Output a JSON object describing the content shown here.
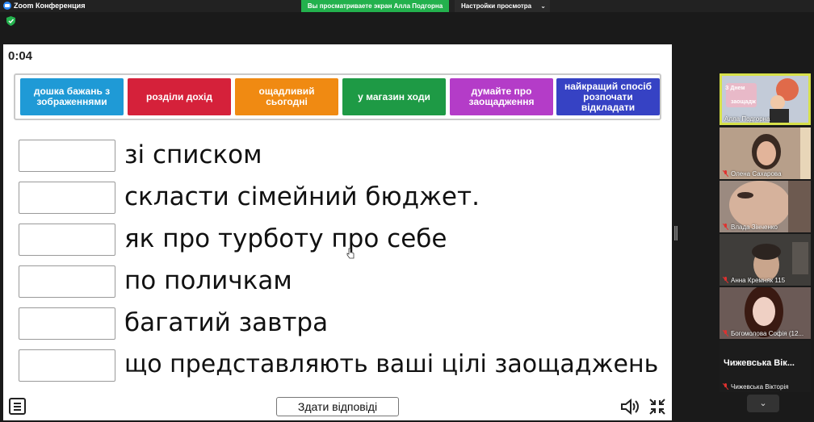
{
  "window": {
    "app_title": "Zoom Конференция",
    "share_banner": "Вы просматриваете экран Алла Подгорна",
    "view_settings": "Настройки просмотра"
  },
  "activity": {
    "timer": "0:04",
    "word_bank": [
      {
        "label": "дошка бажань з зображеннями",
        "color": "#1f9ad6"
      },
      {
        "label": "розділи дохід",
        "color": "#d5213a"
      },
      {
        "label": "ощадливий сьогодні",
        "color": "#f08a12"
      },
      {
        "label": "у магазин ходи",
        "color": "#1e9a45"
      },
      {
        "label": "думайте про заощадження",
        "color": "#b43cc8"
      },
      {
        "label": "найкращий спосіб розпочати відкладати",
        "color": "#3642c4"
      }
    ],
    "answers": [
      "зі списком",
      "скласти сімейний бюджет.",
      "як про турботу про себе",
      "по поличкам",
      "багатий завтра",
      "що представляють ваші цілі заощаджень"
    ],
    "submit_label": "Здати відповіді"
  },
  "participants": [
    {
      "name": "Алла Подгорна",
      "active": true,
      "overlay": [
        "З Днем",
        "заощадж"
      ]
    },
    {
      "name": "Олена Сахарова",
      "muted": true
    },
    {
      "name": "Влада Зінченко",
      "muted": true
    },
    {
      "name": "Анна Кремняк 115",
      "muted": true
    },
    {
      "name": "Богомолова Софія (12...",
      "muted": true
    },
    {
      "name": "Чижевська Вікторія",
      "muted": true,
      "display_name": "Чижевська Вік..."
    }
  ],
  "colors": {
    "banner_green": "#23b14d",
    "active_border": "#d7e04a",
    "muted_red": "#e0312f"
  }
}
